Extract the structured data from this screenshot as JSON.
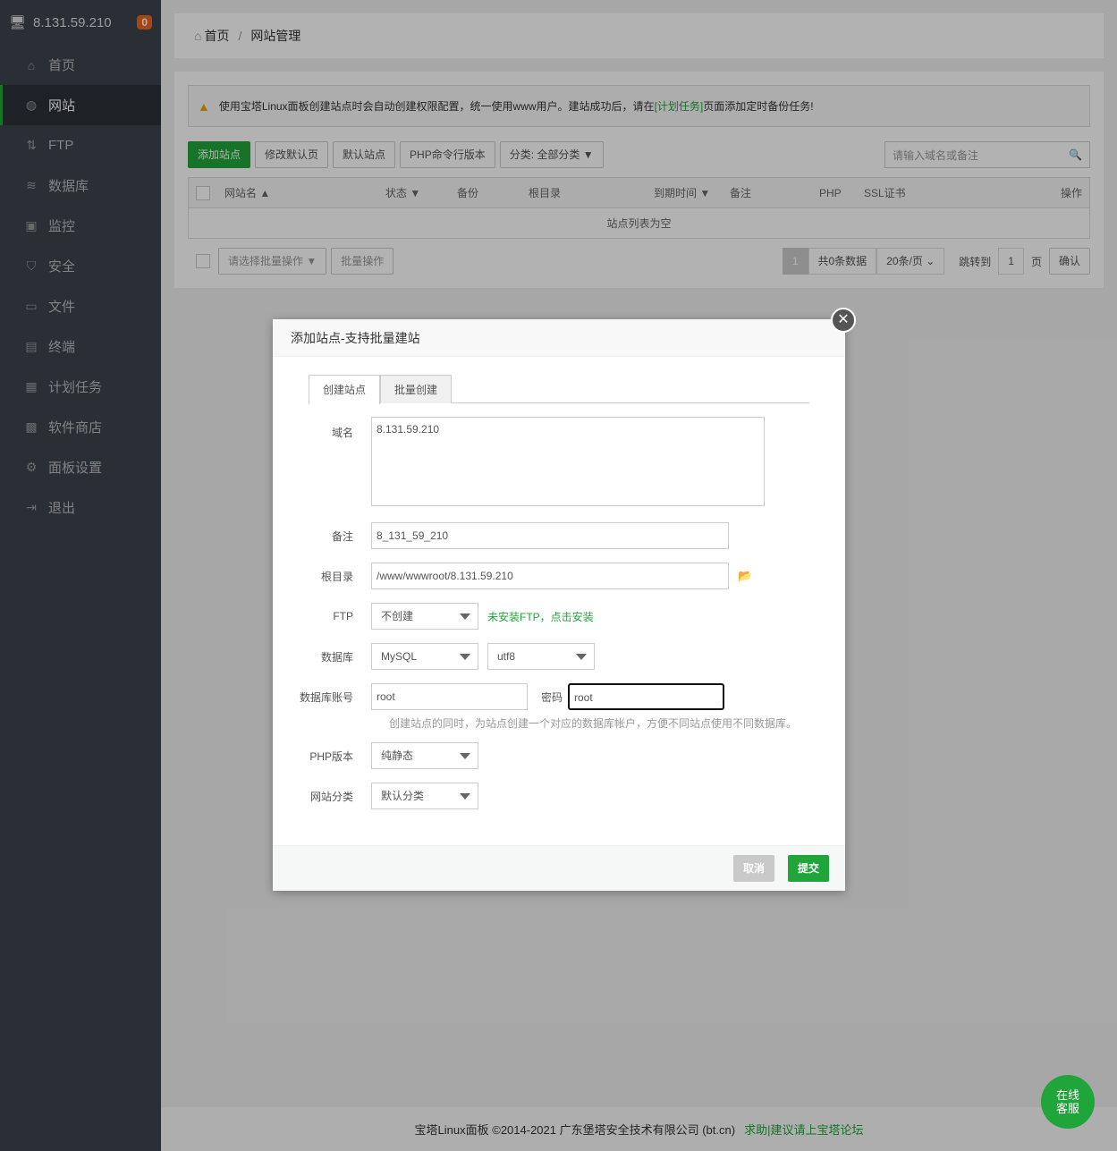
{
  "sidebar": {
    "server_ip": "8.131.59.210",
    "badge": "0",
    "items": [
      {
        "label": "首页",
        "icon": "home-icon"
      },
      {
        "label": "网站",
        "icon": "globe-icon",
        "active": true
      },
      {
        "label": "FTP",
        "icon": "ftp-icon"
      },
      {
        "label": "数据库",
        "icon": "database-icon"
      },
      {
        "label": "监控",
        "icon": "monitor-icon"
      },
      {
        "label": "安全",
        "icon": "shield-icon"
      },
      {
        "label": "文件",
        "icon": "folder-icon"
      },
      {
        "label": "终端",
        "icon": "terminal-icon"
      },
      {
        "label": "计划任务",
        "icon": "calendar-icon"
      },
      {
        "label": "软件商店",
        "icon": "apps-icon"
      },
      {
        "label": "面板设置",
        "icon": "gear-icon"
      },
      {
        "label": "退出",
        "icon": "logout-icon"
      }
    ]
  },
  "breadcrumb": {
    "home": "首页",
    "sep": "/",
    "current": "网站管理"
  },
  "alert": {
    "pre": "使用宝塔Linux面板创建站点时会自动创建权限配置，统一使用www用户。建站成功后，请在",
    "link": "[计划任务]",
    "post": "页面添加定时备份任务!"
  },
  "toolbar": {
    "add": "添加站点",
    "modify_default": "修改默认页",
    "default_site": "默认站点",
    "php_cli": "PHP命令行版本",
    "category": "分类: 全部分类",
    "search_placeholder": "请输入域名或备注"
  },
  "table": {
    "headers": [
      "网站名",
      "状态",
      "备份",
      "根目录",
      "到期时间",
      "备注",
      "PHP",
      "SSL证书",
      "操作"
    ],
    "empty": "站点列表为空"
  },
  "pager": {
    "batch_placeholder": "请选择批量操作",
    "batch_btn": "批量操作",
    "page": "1",
    "total": "共0条数据",
    "per_page": "20条/页",
    "jump": "跳转到",
    "jump_val": "1",
    "page_unit": "页",
    "confirm": "确认"
  },
  "modal": {
    "title": "添加站点-支持批量建站",
    "tabs": [
      "创建站点",
      "批量创建"
    ],
    "domain_label": "域名",
    "domain": "8.131.59.210",
    "remark_label": "备注",
    "remark": "8_131_59_210",
    "root_label": "根目录",
    "root": "/www/wwwroot/8.131.59.210",
    "ftp_label": "FTP",
    "ftp": "不创建",
    "ftp_hint": "未安装FTP，点击安装",
    "db_label": "数据库",
    "db": "MySQL",
    "charset": "utf8",
    "dbuser_label": "数据库账号",
    "dbuser": "root",
    "pwd_label": "密码",
    "pwd": "root",
    "db_hint": "创建站点的同时，为站点创建一个对应的数据库帐户，方便不同站点使用不同数据库。",
    "php_label": "PHP版本",
    "php": "纯静态",
    "cat_label": "网站分类",
    "cat": "默认分类",
    "cancel": "取消",
    "submit": "提交"
  },
  "footer": {
    "copyright": "宝塔Linux面板 ©2014-2021 广东堡塔安全技术有限公司 (bt.cn)",
    "link": "求助|建议请上宝塔论坛"
  },
  "kefu": {
    "line1": "在线",
    "line2": "客服"
  }
}
